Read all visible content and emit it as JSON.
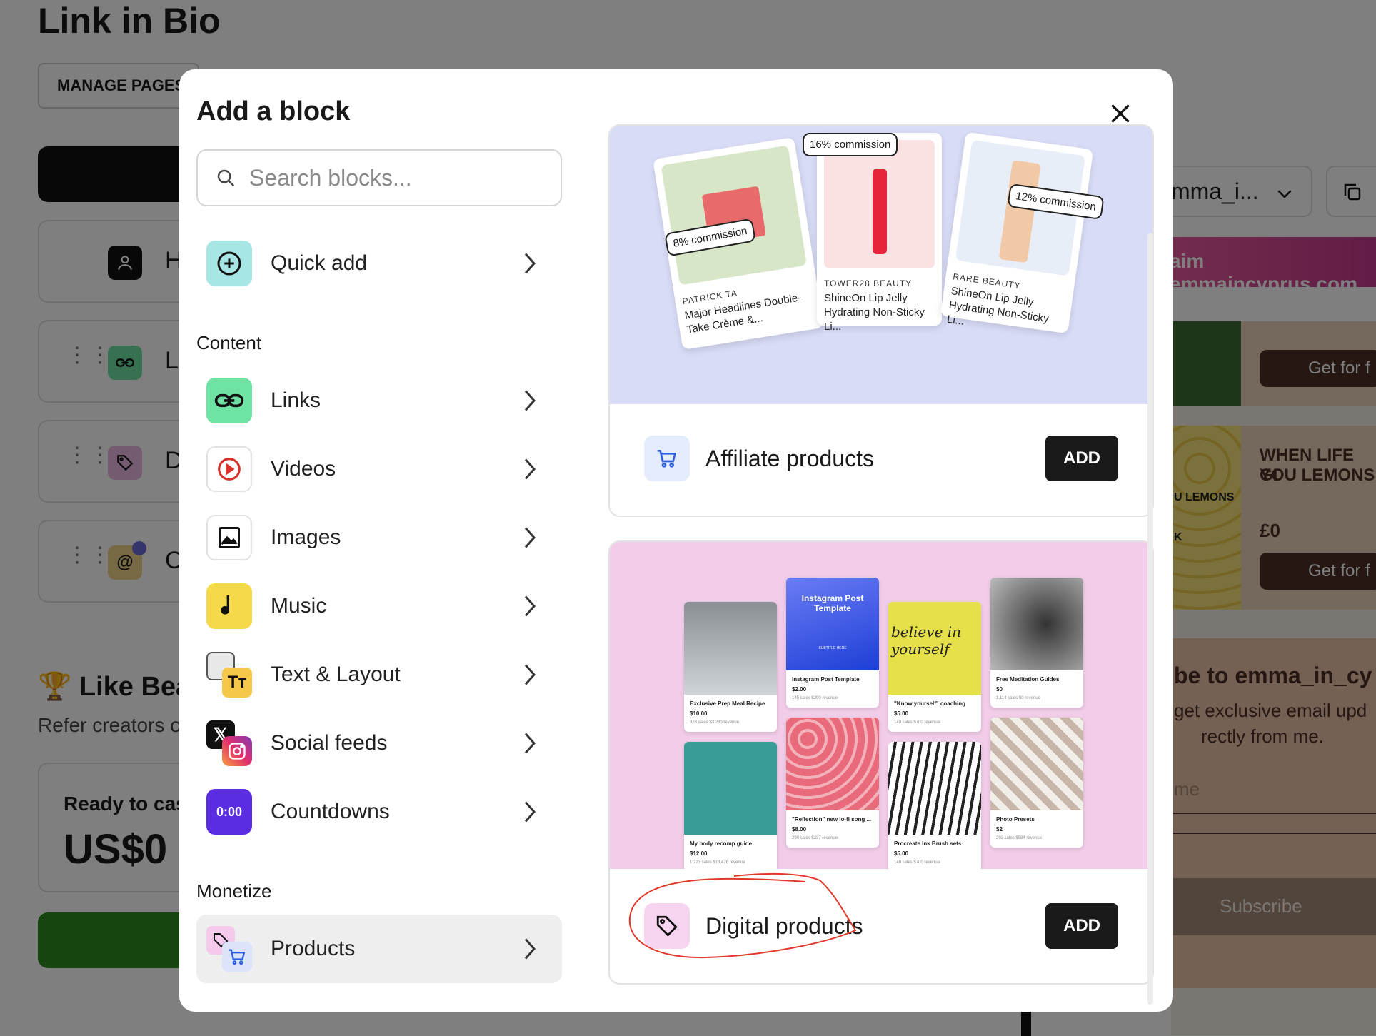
{
  "background": {
    "page_title": "Link in Bio",
    "manage_pages": "MANAGE PAGES",
    "block_letters": [
      "H",
      "Li",
      "D",
      "C"
    ],
    "like_heading": "Like Bea",
    "refer_text": "Refer creators o",
    "ready_label": "Ready to cas",
    "ready_amount": "US$0",
    "right": {
      "username_select": "mma_i...",
      "claim_banner": "aim emmaincyprus.com",
      "get_for_1": "Get for f",
      "when_life": "WHEN LIFE GI",
      "you_lemons": "YOU LEMONS",
      "lemon_text": "U LEMONS",
      "lemon_ok": "K",
      "price": "£0",
      "get_for_2": "Get for f",
      "subscribe_heading": "be to emma_in_cy",
      "subscribe_sub1": "get exclusive email upd",
      "subscribe_sub2": "rectly from me.",
      "name_placeholder": "me",
      "subscribe_btn": "Subscribe"
    }
  },
  "modal": {
    "title": "Add a block",
    "search_placeholder": "Search blocks...",
    "quick_add": "Quick add",
    "sections": {
      "content": "Content",
      "monetize": "Monetize"
    },
    "content_items": [
      {
        "label": "Links",
        "icon": "link-icon"
      },
      {
        "label": "Videos",
        "icon": "play-icon"
      },
      {
        "label": "Images",
        "icon": "image-icon"
      },
      {
        "label": "Music",
        "icon": "music-note-icon"
      },
      {
        "label": "Text & Layout",
        "icon": "text-layout-icon"
      },
      {
        "label": "Social feeds",
        "icon": "social-feeds-icon"
      },
      {
        "label": "Countdowns",
        "icon": "countdown-icon",
        "icon_text": "0:00"
      }
    ],
    "monetize_items": [
      {
        "label": "Products",
        "icon": "products-icon"
      }
    ],
    "cards": [
      {
        "label": "Affiliate products",
        "add": "ADD",
        "preview": {
          "commissions": [
            "8% commission",
            "16% commission",
            "12% commission"
          ],
          "products": [
            {
              "brand": "PATRICK TA",
              "name": "Major Headlines Double-Take Crème &..."
            },
            {
              "brand": "TOWER28 BEAUTY",
              "name": "ShineOn Lip Jelly Hydrating Non-Sticky Li..."
            },
            {
              "brand": "RARE BEAUTY",
              "name": "ShineOn Lip Jelly Hydrating Non-Sticky Li..."
            }
          ]
        }
      },
      {
        "label": "Digital products",
        "add": "ADD",
        "preview": {
          "template_title": "Instagram Post Template",
          "template_sub": "SUBTITLE HERE",
          "believe_text": "believe in yourself",
          "products": [
            {
              "name": "Exclusive Prep Meal Recipe",
              "price": "$10.00",
              "stats": "328 sales   $3,280 revenue"
            },
            {
              "name": "Instagram Post Template",
              "price": "$2.00",
              "stats": "145 sales   $290 revenue"
            },
            {
              "name": "\"Know yourself\" coaching",
              "price": "$5.00",
              "stats": "140 sales   $700 revenue"
            },
            {
              "name": "Free Meditation Guides",
              "price": "$0",
              "stats": "1,114 sales   $0 revenue"
            },
            {
              "name": "My body recomp guide",
              "price": "$12.00",
              "stats": "1,223 sales   $13,476 revenue"
            },
            {
              "name": "\"Reflection\" new lo-fi song ...",
              "price": "$8.00",
              "stats": "290 sales   $237 revenue"
            },
            {
              "name": "Procreate Ink Brush sets",
              "price": "$5.00",
              "stats": "140 sales   $700 revenue"
            },
            {
              "name": "Photo Presets",
              "price": "$2",
              "stats": "292 sales   $584 revenue"
            }
          ]
        }
      }
    ]
  },
  "colors": {
    "overlay": "rgba(0,0,0,0.5)",
    "links_green": "#6ee3a4",
    "quick_add_teal": "#a8e6e6",
    "music_yellow": "#f5d94a",
    "countdown_purple": "#5b2de0",
    "affiliate_bg": "#d9dcf7",
    "digital_bg": "#f2cde9",
    "annotation_red": "#e0392b"
  }
}
